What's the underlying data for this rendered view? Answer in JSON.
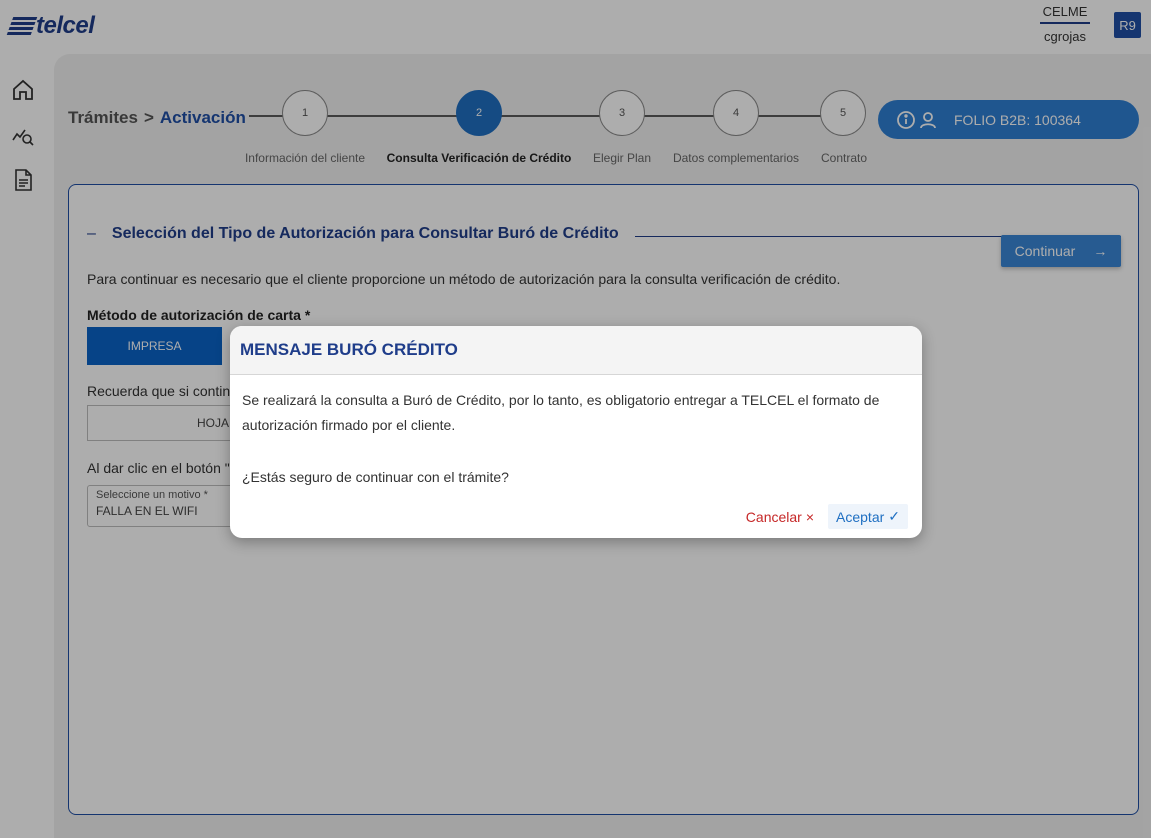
{
  "header": {
    "logo_text": "telcel",
    "role": "CELME",
    "username": "cgrojas",
    "region": "R9"
  },
  "sidenav": {
    "icons": [
      "home-icon",
      "analytics-search-icon",
      "document-icon"
    ]
  },
  "breadcrumb": {
    "root": "Trámites",
    "separator": ">",
    "current": "Activación"
  },
  "stepper": {
    "steps": [
      {
        "number": "1",
        "label": "Información del cliente"
      },
      {
        "number": "2",
        "label": "Consulta Verificación de Crédito",
        "current": true
      },
      {
        "number": "3",
        "label": "Elegir Plan"
      },
      {
        "number": "4",
        "label": "Datos complementarios"
      },
      {
        "number": "5",
        "label": "Contrato"
      }
    ]
  },
  "folio": {
    "label": "FOLIO B2B: 100364",
    "icons": [
      "info-icon",
      "user-icon"
    ]
  },
  "section": {
    "toggle": "–",
    "title": "Selección del Tipo de Autorización para Consultar Buró de Crédito",
    "continue_label": "Continuar",
    "intro": "Para continuar es necesario que el cliente proporcione un método de autorización para la consulta verificación de crédito.",
    "method_label": "Método de autorización de carta *",
    "method_option": "IMPRESA",
    "reminder_partial": "Recuerda que si contin",
    "hoja_partial": "HOJA DE BUR",
    "note_partial": "Al dar clic en el botón \"",
    "select_label": "Seleccione un motivo *",
    "select_value": "FALLA EN EL WIFI"
  },
  "modal": {
    "title": "MENSAJE BURÓ CRÉDITO",
    "message_line1": "Se realizará la consulta a Buró de Crédito, por lo tanto, es obligatorio entregar a TELCEL el formato de",
    "message_line2": "autorización firmado por el cliente.",
    "question": "¿Estás seguro de continuar con el trámite?",
    "cancel_label": "Cancelar",
    "cancel_icon": "×",
    "accept_label": "Aceptar",
    "accept_icon": "✓"
  },
  "colors": {
    "brand": "#1f3d8a",
    "primary": "#1f6fc2",
    "danger": "#c62828"
  }
}
